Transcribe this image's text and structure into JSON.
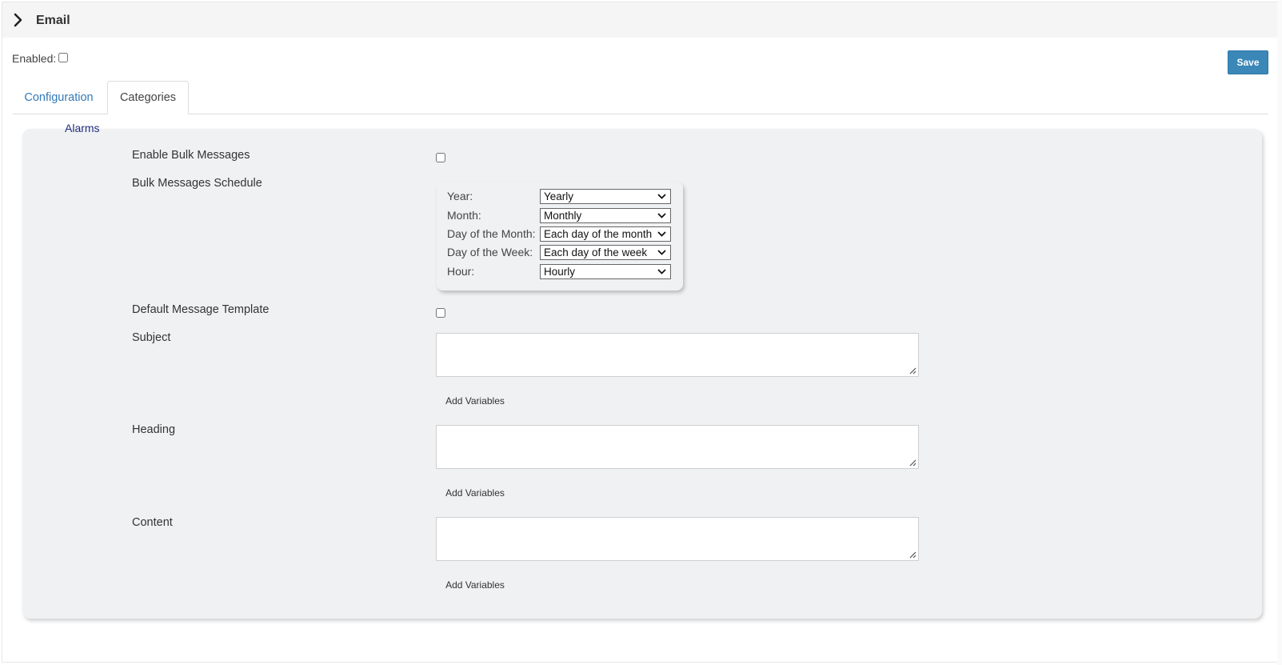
{
  "header": {
    "title": "Email",
    "toggle_icon": "chevron-right-icon"
  },
  "enabled": {
    "label": "Enabled:",
    "checked": false
  },
  "toolbar": {
    "save_label": "Save",
    "accent": "#3a87b8"
  },
  "tabs": [
    {
      "label": "Configuration",
      "active": false
    },
    {
      "label": "Categories",
      "active": true
    }
  ],
  "section": {
    "title": "Alarms"
  },
  "form": {
    "enable_bulk": {
      "label": "Enable Bulk Messages",
      "checked": false
    },
    "schedule": {
      "label": "Bulk Messages Schedule",
      "rows": [
        {
          "label": "Year:",
          "value": "Yearly"
        },
        {
          "label": "Month:",
          "value": "Monthly"
        },
        {
          "label": "Day of the Month:",
          "value": "Each day of the month"
        },
        {
          "label": "Day of the Week:",
          "value": "Each day of the week"
        },
        {
          "label": "Hour:",
          "value": "Hourly"
        }
      ]
    },
    "default_template": {
      "label": "Default Message Template",
      "checked": false
    },
    "subject": {
      "label": "Subject",
      "value": "",
      "add_label": "Add Variables"
    },
    "heading": {
      "label": "Heading",
      "value": "",
      "add_label": "Add Variables"
    },
    "content": {
      "label": "Content",
      "value": "",
      "add_label": "Add Variables"
    }
  }
}
